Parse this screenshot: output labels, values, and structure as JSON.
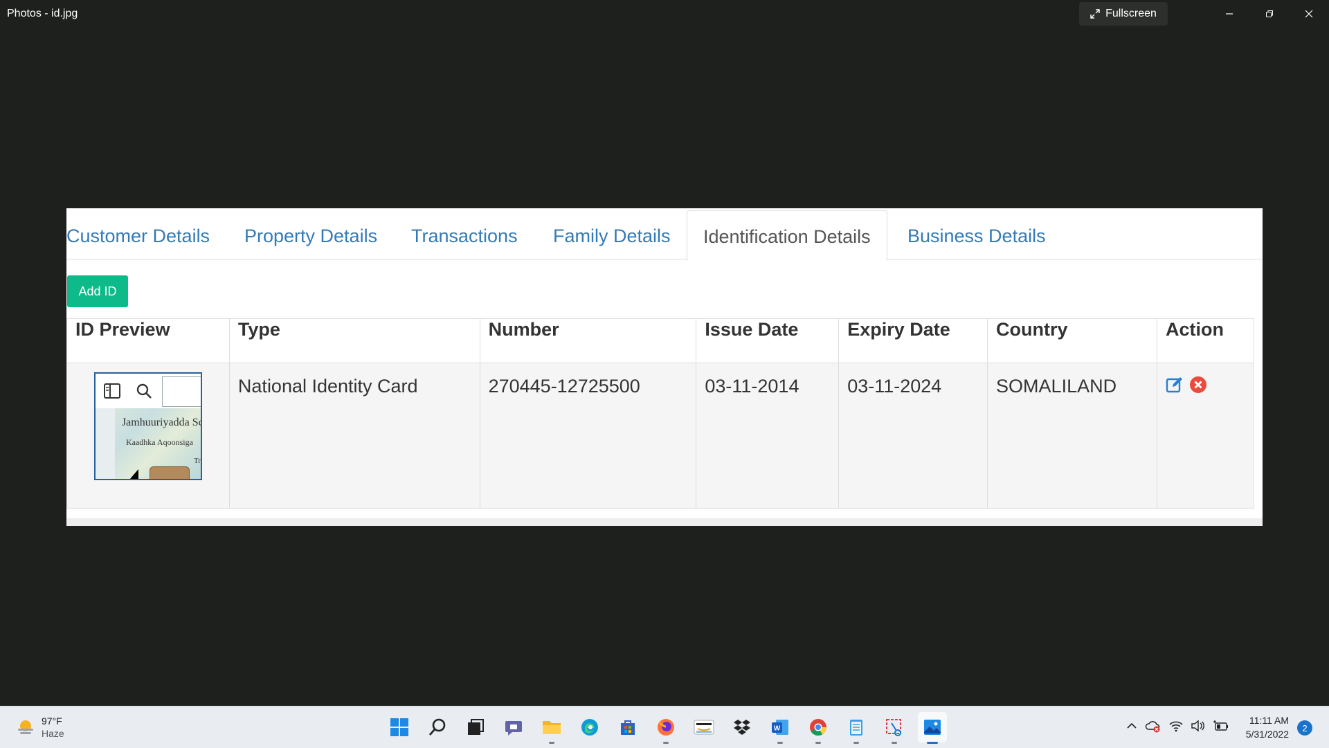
{
  "window": {
    "title": "Photos - id.jpg",
    "fullscreen_label": "Fullscreen"
  },
  "page": {
    "tabs": [
      {
        "label": "Customer Details"
      },
      {
        "label": "Property Details"
      },
      {
        "label": "Transactions"
      },
      {
        "label": "Family Details"
      },
      {
        "label": "Identification Details",
        "active": true
      },
      {
        "label": "Business Details"
      }
    ],
    "add_button_label": "Add ID",
    "table": {
      "headers": [
        "ID Preview",
        "Type",
        "Number",
        "Issue Date",
        "Expiry Date",
        "Country",
        "Action"
      ],
      "rows": [
        {
          "type": "National Identity Card",
          "number": "270445-12725500",
          "issue_date": "03-11-2014",
          "expiry_date": "03-11-2024",
          "country": "SOMALILAND",
          "preview_text_1": "Jamhuuriyadda Sc",
          "preview_text_2": "Kaadhka  Aqoonsiga",
          "preview_text_3": "Tr"
        }
      ]
    }
  },
  "taskbar": {
    "weather": {
      "temp": "97°F",
      "condition": "Haze"
    },
    "clock": {
      "time": "11:11 AM",
      "date": "5/31/2022"
    },
    "notification_count": "2",
    "apps": [
      "start-icon",
      "search-icon",
      "task-view-icon",
      "teams-chat-icon",
      "file-explorer-icon",
      "edge-icon",
      "store-icon",
      "firefox-icon",
      "amazon-icon",
      "dropbox-icon",
      "word-icon",
      "chrome-icon",
      "notepad-icon",
      "snipping-tool-icon",
      "photos-icon"
    ]
  },
  "colors": {
    "tab_link": "#337ab7",
    "tab_active": "#555555",
    "add_button": "#0fba8a",
    "edit_icon": "#2a7fd0",
    "delete_icon": "#e94b3c",
    "background": "#1d201d"
  }
}
